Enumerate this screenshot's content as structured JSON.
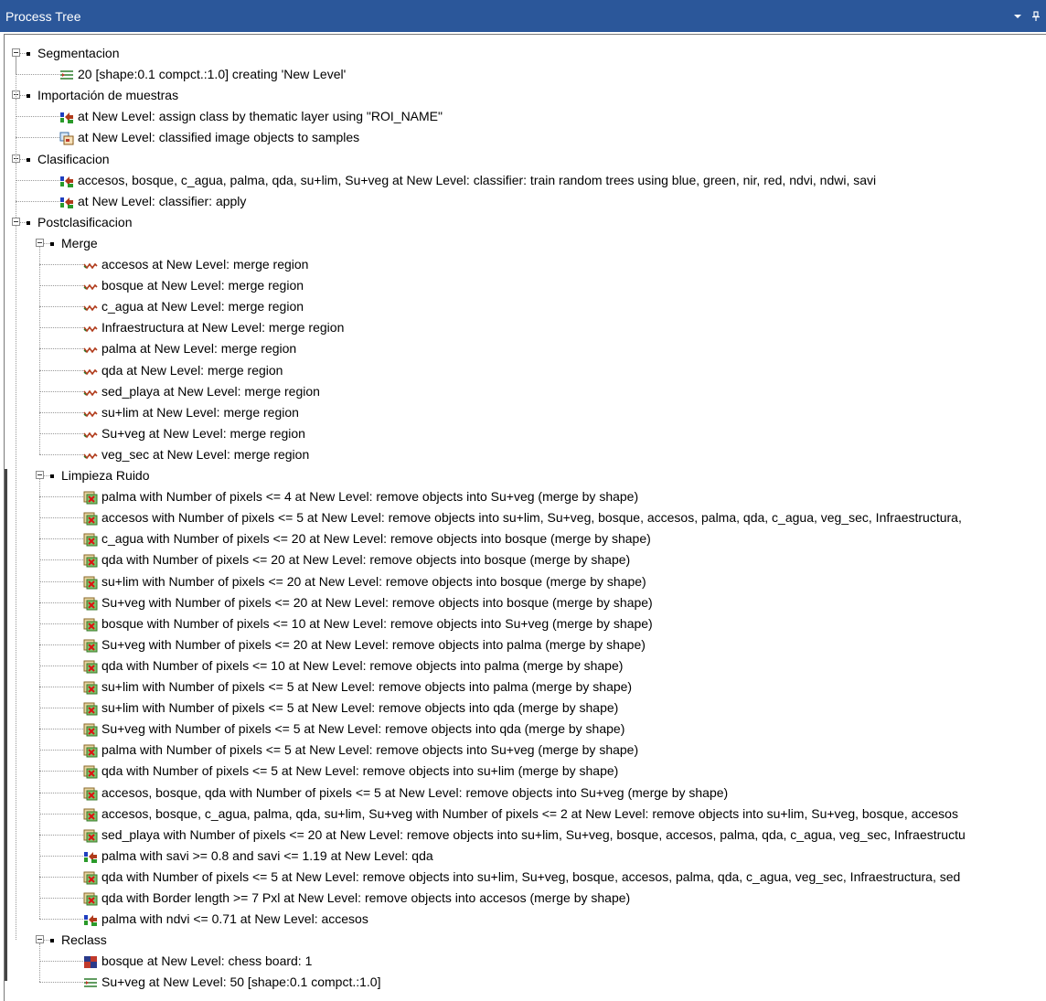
{
  "panel": {
    "title": "Process Tree",
    "dropdown_icon": "chevron-down-icon",
    "pin_icon": "pin-icon"
  },
  "tree": [
    {
      "type": "group",
      "level": 0,
      "label": "Segmentacion"
    },
    {
      "type": "item",
      "level": 1,
      "icon": "segmentation-icon",
      "label": "20 [shape:0.1 compct.:1.0] creating 'New Level'"
    },
    {
      "type": "group",
      "level": 0,
      "label": "Importación de muestras"
    },
    {
      "type": "item",
      "level": 1,
      "icon": "assign-class-icon",
      "label": "at  New Level: assign class by thematic layer using \"ROI_NAME\""
    },
    {
      "type": "item",
      "level": 1,
      "icon": "samples-icon",
      "label": "at  New Level: classified image objects to samples"
    },
    {
      "type": "group",
      "level": 0,
      "label": "Clasificacion"
    },
    {
      "type": "item",
      "level": 1,
      "icon": "assign-class-icon",
      "label": "accesos, bosque, c_agua, palma, qda, su+lim, Su+veg at  New Level: classifier: train random trees using blue, green, nir, red, ndvi, ndwi, savi"
    },
    {
      "type": "item",
      "level": 1,
      "icon": "assign-class-icon",
      "label": "at  New Level: classifier: apply"
    },
    {
      "type": "group",
      "level": 0,
      "label": "Postclasificacion"
    },
    {
      "type": "group",
      "level": 1,
      "label": "Merge"
    },
    {
      "type": "item",
      "level": 2,
      "icon": "merge-region-icon",
      "label": "accesos at  New Level: merge region"
    },
    {
      "type": "item",
      "level": 2,
      "icon": "merge-region-icon",
      "label": "bosque at  New Level: merge region"
    },
    {
      "type": "item",
      "level": 2,
      "icon": "merge-region-icon",
      "label": "c_agua at  New Level: merge region"
    },
    {
      "type": "item",
      "level": 2,
      "icon": "merge-region-icon",
      "label": "Infraestructura at  New Level: merge region"
    },
    {
      "type": "item",
      "level": 2,
      "icon": "merge-region-icon",
      "label": "palma at  New Level: merge region"
    },
    {
      "type": "item",
      "level": 2,
      "icon": "merge-region-icon",
      "label": "qda at  New Level: merge region"
    },
    {
      "type": "item",
      "level": 2,
      "icon": "merge-region-icon",
      "label": "sed_playa at  New Level: merge region"
    },
    {
      "type": "item",
      "level": 2,
      "icon": "merge-region-icon",
      "label": "su+lim at  New Level: merge region"
    },
    {
      "type": "item",
      "level": 2,
      "icon": "merge-region-icon",
      "label": "Su+veg at  New Level: merge region"
    },
    {
      "type": "item",
      "level": 2,
      "icon": "merge-region-icon",
      "label": "veg_sec at  New Level: merge region"
    },
    {
      "type": "group",
      "level": 1,
      "label": "Limpieza Ruido"
    },
    {
      "type": "item",
      "level": 2,
      "icon": "remove-objects-icon",
      "label": "palma with Number of pixels <= 4  at  New Level: remove objects into Su+veg (merge by shape)"
    },
    {
      "type": "item",
      "level": 2,
      "icon": "remove-objects-icon",
      "label": "accesos with Number of pixels <= 5  at  New Level: remove objects into su+lim, Su+veg, bosque, accesos, palma, qda, c_agua, veg_sec, Infraestructura,"
    },
    {
      "type": "item",
      "level": 2,
      "icon": "remove-objects-icon",
      "label": "c_agua with Number of pixels <= 20  at  New Level: remove objects into bosque (merge by shape)"
    },
    {
      "type": "item",
      "level": 2,
      "icon": "remove-objects-icon",
      "label": "qda with Number of pixels <= 20  at  New Level: remove objects into bosque (merge by shape)"
    },
    {
      "type": "item",
      "level": 2,
      "icon": "remove-objects-icon",
      "label": "su+lim with Number of pixels <= 20  at  New Level: remove objects into bosque (merge by shape)"
    },
    {
      "type": "item",
      "level": 2,
      "icon": "remove-objects-icon",
      "label": "Su+veg with Number of pixels <= 20  at  New Level: remove objects into bosque (merge by shape)"
    },
    {
      "type": "item",
      "level": 2,
      "icon": "remove-objects-icon",
      "label": "bosque with Number of pixels <= 10  at  New Level: remove objects into Su+veg (merge by shape)"
    },
    {
      "type": "item",
      "level": 2,
      "icon": "remove-objects-icon",
      "label": "Su+veg with Number of pixels <= 20  at  New Level: remove objects into palma (merge by shape)"
    },
    {
      "type": "item",
      "level": 2,
      "icon": "remove-objects-icon",
      "label": "qda with Number of pixels <= 10  at  New Level: remove objects into palma (merge by shape)"
    },
    {
      "type": "item",
      "level": 2,
      "icon": "remove-objects-icon",
      "label": "su+lim with Number of pixels <= 5  at  New Level: remove objects into palma (merge by shape)"
    },
    {
      "type": "item",
      "level": 2,
      "icon": "remove-objects-icon",
      "label": "su+lim with Number of pixels <= 5  at  New Level: remove objects into qda (merge by shape)"
    },
    {
      "type": "item",
      "level": 2,
      "icon": "remove-objects-icon",
      "label": "Su+veg with Number of pixels <= 5  at  New Level: remove objects into qda (merge by shape)"
    },
    {
      "type": "item",
      "level": 2,
      "icon": "remove-objects-icon",
      "label": "palma with Number of pixels <= 5  at  New Level: remove objects into Su+veg (merge by shape)"
    },
    {
      "type": "item",
      "level": 2,
      "icon": "remove-objects-icon",
      "label": "qda with Number of pixels <= 5  at  New Level: remove objects into su+lim (merge by shape)"
    },
    {
      "type": "item",
      "level": 2,
      "icon": "remove-objects-icon",
      "label": "accesos, bosque, qda with Number of pixels <= 5  at  New Level: remove objects into Su+veg (merge by shape)"
    },
    {
      "type": "item",
      "level": 2,
      "icon": "remove-objects-icon",
      "label": "accesos, bosque, c_agua, palma, qda, su+lim, Su+veg with Number of pixels <= 2  at  New Level: remove objects into su+lim, Su+veg, bosque, accesos"
    },
    {
      "type": "item",
      "level": 2,
      "icon": "remove-objects-icon",
      "label": "sed_playa with Number of pixels <= 20  at  New Level: remove objects into su+lim, Su+veg, bosque, accesos, palma, qda, c_agua, veg_sec, Infraestructu"
    },
    {
      "type": "item",
      "level": 2,
      "icon": "assign-class-icon",
      "label": "palma with savi >= 0.8  and savi <= 1.19  at  New Level: qda"
    },
    {
      "type": "item",
      "level": 2,
      "icon": "remove-objects-icon",
      "label": "qda with Number of pixels <= 5  at  New Level: remove objects into su+lim, Su+veg, bosque, accesos, palma, qda, c_agua, veg_sec, Infraestructura, sed"
    },
    {
      "type": "item",
      "level": 2,
      "icon": "remove-objects-icon",
      "label": "qda with Border length >= 7 Pxl at  New Level: remove objects into accesos (merge by shape)"
    },
    {
      "type": "item",
      "level": 2,
      "icon": "assign-class-icon",
      "label": "palma with ndvi <= 0.71  at  New Level: accesos"
    },
    {
      "type": "group",
      "level": 1,
      "label": "Reclass"
    },
    {
      "type": "item",
      "level": 2,
      "icon": "chessboard-icon",
      "label": "bosque at  New Level: chess board: 1"
    },
    {
      "type": "item",
      "level": 2,
      "icon": "segmentation-icon",
      "label": "Su+veg at  New Level: 50 [shape:0.1 compct.:1.0]"
    }
  ]
}
